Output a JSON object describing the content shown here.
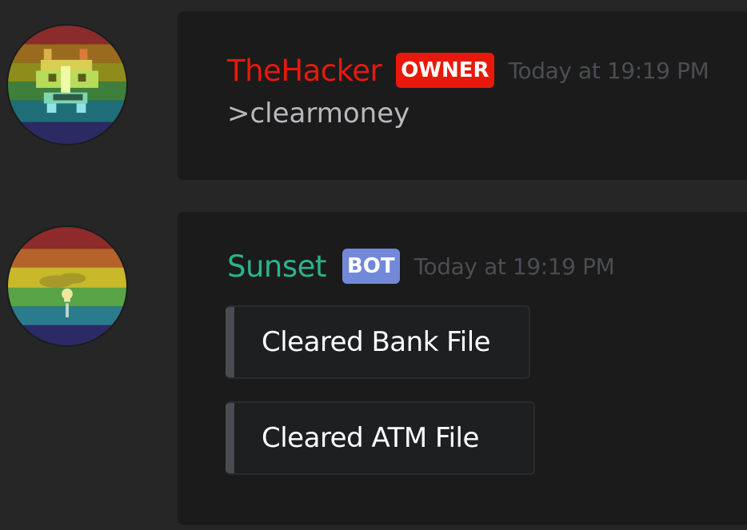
{
  "messages": [
    {
      "author": "TheHacker",
      "author_color": "#e8190c",
      "badge": "OWNER",
      "badge_color": "#e8190c",
      "timestamp": "Today at 19:19 PM",
      "text": ">clearmoney",
      "avatar_icon": "pixel-space-invader-rainbow-avatar"
    },
    {
      "author": "Sunset",
      "author_color": "#2bb48c",
      "badge": "BOT",
      "badge_color": "#7289da",
      "timestamp": "Today at 19:19 PM",
      "avatar_icon": "rainbow-sunset-avatar",
      "embeds": [
        {
          "text": "Cleared Bank File"
        },
        {
          "text": "Cleared ATM File"
        }
      ]
    }
  ]
}
